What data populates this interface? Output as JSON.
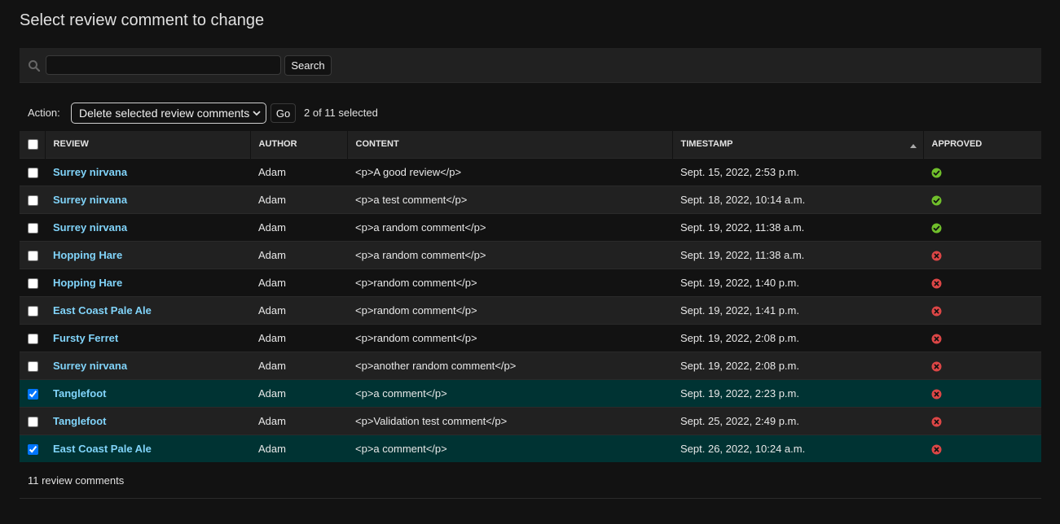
{
  "page": {
    "title": "Select review comment to change"
  },
  "search": {
    "value": "",
    "placeholder": "",
    "button_label": "Search"
  },
  "actions": {
    "label": "Action:",
    "selected_action": "Delete selected review comments",
    "go_label": "Go",
    "counter": "2 of 11 selected"
  },
  "table": {
    "columns": [
      "REVIEW",
      "AUTHOR",
      "CONTENT",
      "TIMESTAMP",
      "APPROVED"
    ],
    "sorted_column": "TIMESTAMP",
    "sort_direction": "ascending",
    "rows": [
      {
        "review": "Surrey nirvana",
        "author": "Adam",
        "content": "<p>A good review</p>",
        "timestamp": "Sept. 15, 2022, 2:53 p.m.",
        "approved": true,
        "selected": false
      },
      {
        "review": "Surrey nirvana",
        "author": "Adam",
        "content": "<p>a test comment</p>",
        "timestamp": "Sept. 18, 2022, 10:14 a.m.",
        "approved": true,
        "selected": false
      },
      {
        "review": "Surrey nirvana",
        "author": "Adam",
        "content": "<p>a random comment</p>",
        "timestamp": "Sept. 19, 2022, 11:38 a.m.",
        "approved": true,
        "selected": false
      },
      {
        "review": "Hopping Hare",
        "author": "Adam",
        "content": "<p>a random comment</p>",
        "timestamp": "Sept. 19, 2022, 11:38 a.m.",
        "approved": false,
        "selected": false
      },
      {
        "review": "Hopping Hare",
        "author": "Adam",
        "content": "<p>random comment</p>",
        "timestamp": "Sept. 19, 2022, 1:40 p.m.",
        "approved": false,
        "selected": false
      },
      {
        "review": "East Coast Pale Ale",
        "author": "Adam",
        "content": "<p>random comment</p>",
        "timestamp": "Sept. 19, 2022, 1:41 p.m.",
        "approved": false,
        "selected": false
      },
      {
        "review": "Fursty Ferret",
        "author": "Adam",
        "content": "<p>random comment</p>",
        "timestamp": "Sept. 19, 2022, 2:08 p.m.",
        "approved": false,
        "selected": false
      },
      {
        "review": "Surrey nirvana",
        "author": "Adam",
        "content": "<p>another random comment</p>",
        "timestamp": "Sept. 19, 2022, 2:08 p.m.",
        "approved": false,
        "selected": false
      },
      {
        "review": "Tanglefoot",
        "author": "Adam",
        "content": "<p>a comment</p>",
        "timestamp": "Sept. 19, 2022, 2:23 p.m.",
        "approved": false,
        "selected": true
      },
      {
        "review": "Tanglefoot",
        "author": "Adam",
        "content": "<p>Validation test comment</p>",
        "timestamp": "Sept. 25, 2022, 2:49 p.m.",
        "approved": false,
        "selected": false
      },
      {
        "review": "East Coast Pale Ale",
        "author": "Adam",
        "content": "<p>a comment</p>",
        "timestamp": "Sept. 26, 2022, 10:24 a.m.",
        "approved": false,
        "selected": true
      }
    ]
  },
  "paginator": {
    "text": "11 review comments"
  },
  "icons": {
    "search": "search-icon",
    "approved_true": "check-circle-icon",
    "approved_false": "x-circle-icon",
    "sort": "sort-ascending-icon",
    "select_chevron": "chevron-down-icon"
  },
  "colors": {
    "background": "#121212",
    "panel": "#212121",
    "selected_row": "#003333",
    "link": "#81d4fa",
    "approved": "#70bf2b",
    "not_approved": "#dd4646"
  }
}
